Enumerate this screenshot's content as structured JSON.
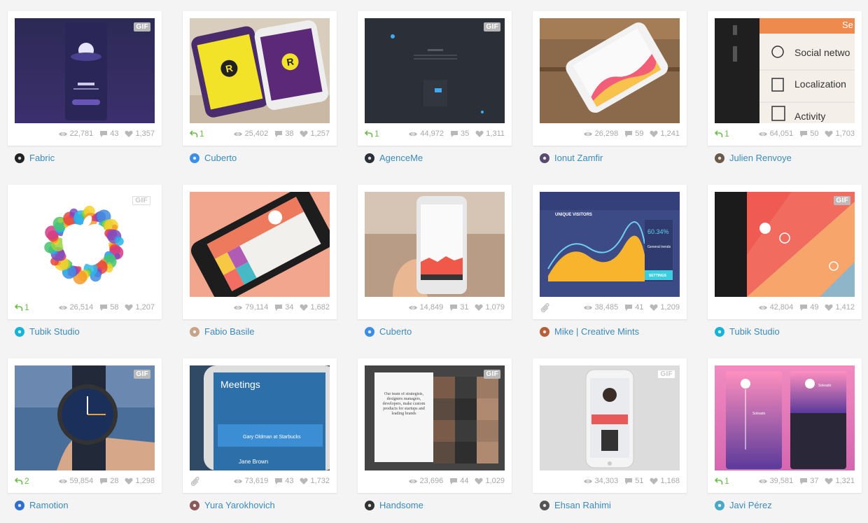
{
  "shots": [
    {
      "designer": "Fabric",
      "views": "22,781",
      "comments": "43",
      "likes": "1,357",
      "gif": true,
      "gif_style": "dark",
      "rebounds": "",
      "attachment": false,
      "avatar_color": "#222",
      "thumb": "fabric"
    },
    {
      "designer": "Cuberto",
      "views": "25,402",
      "comments": "38",
      "likes": "1,257",
      "gif": false,
      "rebounds": "1",
      "attachment": false,
      "avatar_color": "#3d8ee6",
      "thumb": "cuberto1"
    },
    {
      "designer": "AgenceMe",
      "views": "44,972",
      "comments": "35",
      "likes": "1,311",
      "gif": true,
      "gif_style": "dark",
      "rebounds": "1",
      "attachment": false,
      "avatar_color": "#2a2f38",
      "thumb": "agenceme"
    },
    {
      "designer": "Ionut Zamfir",
      "views": "26,298",
      "comments": "59",
      "likes": "1,241",
      "gif": false,
      "rebounds": "",
      "attachment": false,
      "avatar_color": "#5a4b6e",
      "thumb": "ionut"
    },
    {
      "designer": "Julien Renvoye",
      "views": "64,051",
      "comments": "50",
      "likes": "1,703",
      "gif": false,
      "rebounds": "1",
      "attachment": false,
      "avatar_color": "#6b5a4a",
      "thumb": "julien",
      "thumb_labels": [
        "Se",
        "Social netwo",
        "Localization",
        "Activity"
      ]
    },
    {
      "designer": "Tubik Studio",
      "views": "26,514",
      "comments": "58",
      "likes": "1,207",
      "gif": true,
      "gif_style": "light",
      "rebounds": "1",
      "attachment": false,
      "avatar_color": "#18b4d8",
      "thumb": "apple"
    },
    {
      "designer": "Fabio Basile",
      "views": "79,114",
      "comments": "34",
      "likes": "1,682",
      "gif": false,
      "rebounds": "",
      "attachment": false,
      "avatar_color": "#c7a489",
      "thumb": "fabio"
    },
    {
      "designer": "Cuberto",
      "views": "14,849",
      "comments": "31",
      "likes": "1,079",
      "gif": false,
      "rebounds": "",
      "attachment": false,
      "avatar_color": "#3d8ee6",
      "thumb": "cuberto2"
    },
    {
      "designer": "Mike | Creative Mints",
      "views": "38,485",
      "comments": "41",
      "likes": "1,209",
      "gif": false,
      "rebounds": "",
      "attachment": true,
      "avatar_color": "#b85d3a",
      "thumb": "dashboard",
      "thumb_labels": [
        "UNIQUE VISITORS",
        "60.34%",
        "General trends",
        "SETTINGS"
      ]
    },
    {
      "designer": "Tubik Studio",
      "views": "42,804",
      "comments": "49",
      "likes": "1,412",
      "gif": true,
      "gif_style": "dark",
      "rebounds": "",
      "attachment": false,
      "avatar_color": "#18b4d8",
      "thumb": "tubik2"
    },
    {
      "designer": "Ramotion",
      "views": "59,854",
      "comments": "28",
      "likes": "1,298",
      "gif": true,
      "gif_style": "dark",
      "rebounds": "2",
      "attachment": false,
      "avatar_color": "#2f6fd0",
      "thumb": "watch"
    },
    {
      "designer": "Yura Yarokhovich",
      "views": "73,619",
      "comments": "43",
      "likes": "1,732",
      "gif": false,
      "rebounds": "",
      "attachment": true,
      "avatar_color": "#8a5a5a",
      "thumb": "meetings",
      "thumb_labels": [
        "Meetings",
        "Gary Oldman at Starbucks",
        "Jane Brown"
      ]
    },
    {
      "designer": "Handsome",
      "views": "23,696",
      "comments": "44",
      "likes": "1,029",
      "gif": true,
      "gif_style": "dark",
      "rebounds": "",
      "attachment": false,
      "avatar_color": "#333",
      "thumb": "handsome",
      "thumb_labels": [
        "Our team of strategists, designers managers, developers, make custom products for startups and leading brands"
      ]
    },
    {
      "designer": "Ehsan Rahimi",
      "views": "34,303",
      "comments": "51",
      "likes": "1,168",
      "gif": true,
      "gif_style": "light",
      "rebounds": "",
      "attachment": false,
      "avatar_color": "#555",
      "thumb": "ehsan"
    },
    {
      "designer": "Javi Pérez",
      "views": "39,581",
      "comments": "37",
      "likes": "1,321",
      "gif": false,
      "rebounds": "1",
      "attachment": false,
      "avatar_color": "#4aa8c8",
      "thumb": "javi",
      "thumb_labels": [
        "Soleado",
        "Soleado"
      ]
    }
  ],
  "gif_label": "GIF",
  "colors": {
    "link": "#3a8bbb",
    "rebound": "#6bbd4a",
    "meta": "#a8a8a8",
    "card": "#ffffff",
    "bg": "#f4f4f4"
  },
  "icons": {
    "views": "eye-icon",
    "comments": "comment-icon",
    "likes": "heart-icon",
    "rebound": "rebound-arrow-icon",
    "attachment": "paperclip-icon"
  }
}
